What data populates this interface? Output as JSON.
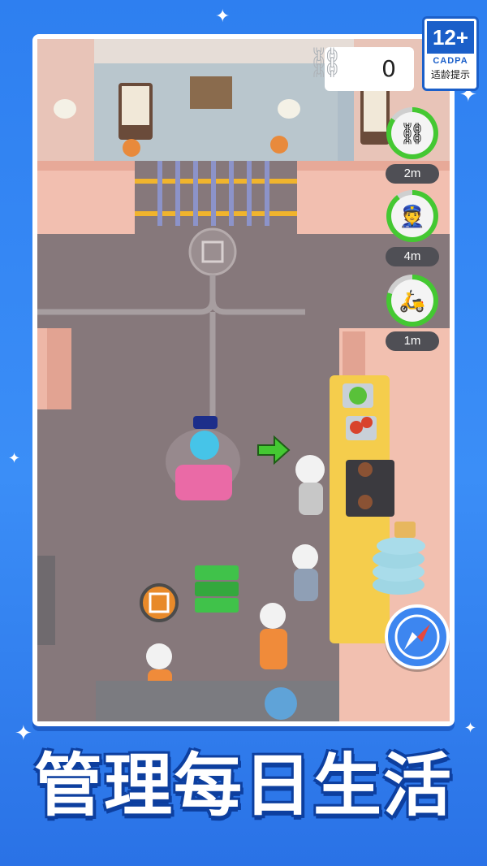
{
  "rating": {
    "age": "12+",
    "org": "CADPA",
    "note": "适龄提示"
  },
  "hud": {
    "handcuff_count": "0"
  },
  "timers": [
    {
      "name": "handcuffs-upgrade",
      "label": "2m",
      "icon": "handcuffs-plus-icon",
      "progress": 0.85
    },
    {
      "name": "guard-hire",
      "label": "4m",
      "icon": "police-officer-icon",
      "progress": 0.9
    },
    {
      "name": "scooter-upgrade",
      "label": "1m",
      "icon": "scooter-icon",
      "progress": 0.8
    }
  ],
  "caption": {
    "text": "管理每日生活"
  },
  "colors": {
    "bg": "#2e7ff0",
    "accent_green": "#44c832",
    "caption_shadow": "#0d3f9f"
  }
}
